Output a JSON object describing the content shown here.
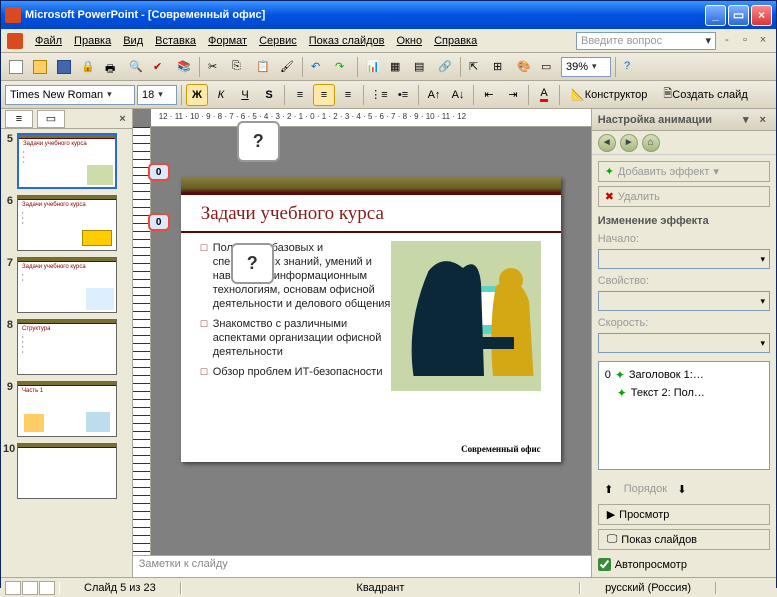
{
  "titlebar": {
    "app": "Microsoft PowerPoint",
    "doc": "[Современный офис]"
  },
  "menu": {
    "file": "Файл",
    "edit": "Правка",
    "view": "Вид",
    "insert": "Вставка",
    "format": "Формат",
    "service": "Сервис",
    "slideshow": "Показ слайдов",
    "window": "Окно",
    "help": "Справка",
    "helpbox": "Введите вопрос"
  },
  "toolbar": {
    "zoom": "39%",
    "font": "Times New Roman",
    "size": "18",
    "bold": "Ж",
    "italic": "К",
    "underline": "Ч",
    "shadow": "S",
    "design": "Конструктор",
    "newslide": "Создать слайд"
  },
  "thumbs": {
    "nums": [
      "5",
      "6",
      "7",
      "8",
      "9",
      "10"
    ],
    "mini_title": "Задачи учебного курса"
  },
  "slide": {
    "title": "Задачи учебного курса",
    "b1": "Получение базовых и специальных знаний, умений и навыков по информационным технологиям, основам офисной деятельности и делового общения",
    "b2": "Знакомство с различными аспектами организации офисной деятельности",
    "b3": "Обзор проблем ИТ-безопасности",
    "footer": "Современный офис",
    "tag": "0",
    "q": "?"
  },
  "taskpane": {
    "title": "Настройка анимации",
    "add": "Добавить эффект",
    "del": "Удалить",
    "section": "Изменение эффекта",
    "start": "Начало:",
    "property": "Свойство:",
    "speed": "Скорость:",
    "item0_num": "0",
    "item0": "Заголовок 1:…",
    "item1": "Текст 2: Пол…",
    "order": "Порядок",
    "preview": "Просмотр",
    "show": "Показ слайдов",
    "auto": "Автопросмотр"
  },
  "notes": "Заметки к слайду",
  "status": {
    "slide": "Слайд 5 из 23",
    "center": "Квадрант",
    "lang": "русский (Россия)"
  },
  "ruler": "12 · 11 · 10 · 9 · 8 · 7 · 6 · 5 · 4 · 3 · 2 · 1 · 0 · 1 · 2 · 3 · 4 · 5 · 6 · 7 · 8 · 9 · 10 · 11 · 12"
}
